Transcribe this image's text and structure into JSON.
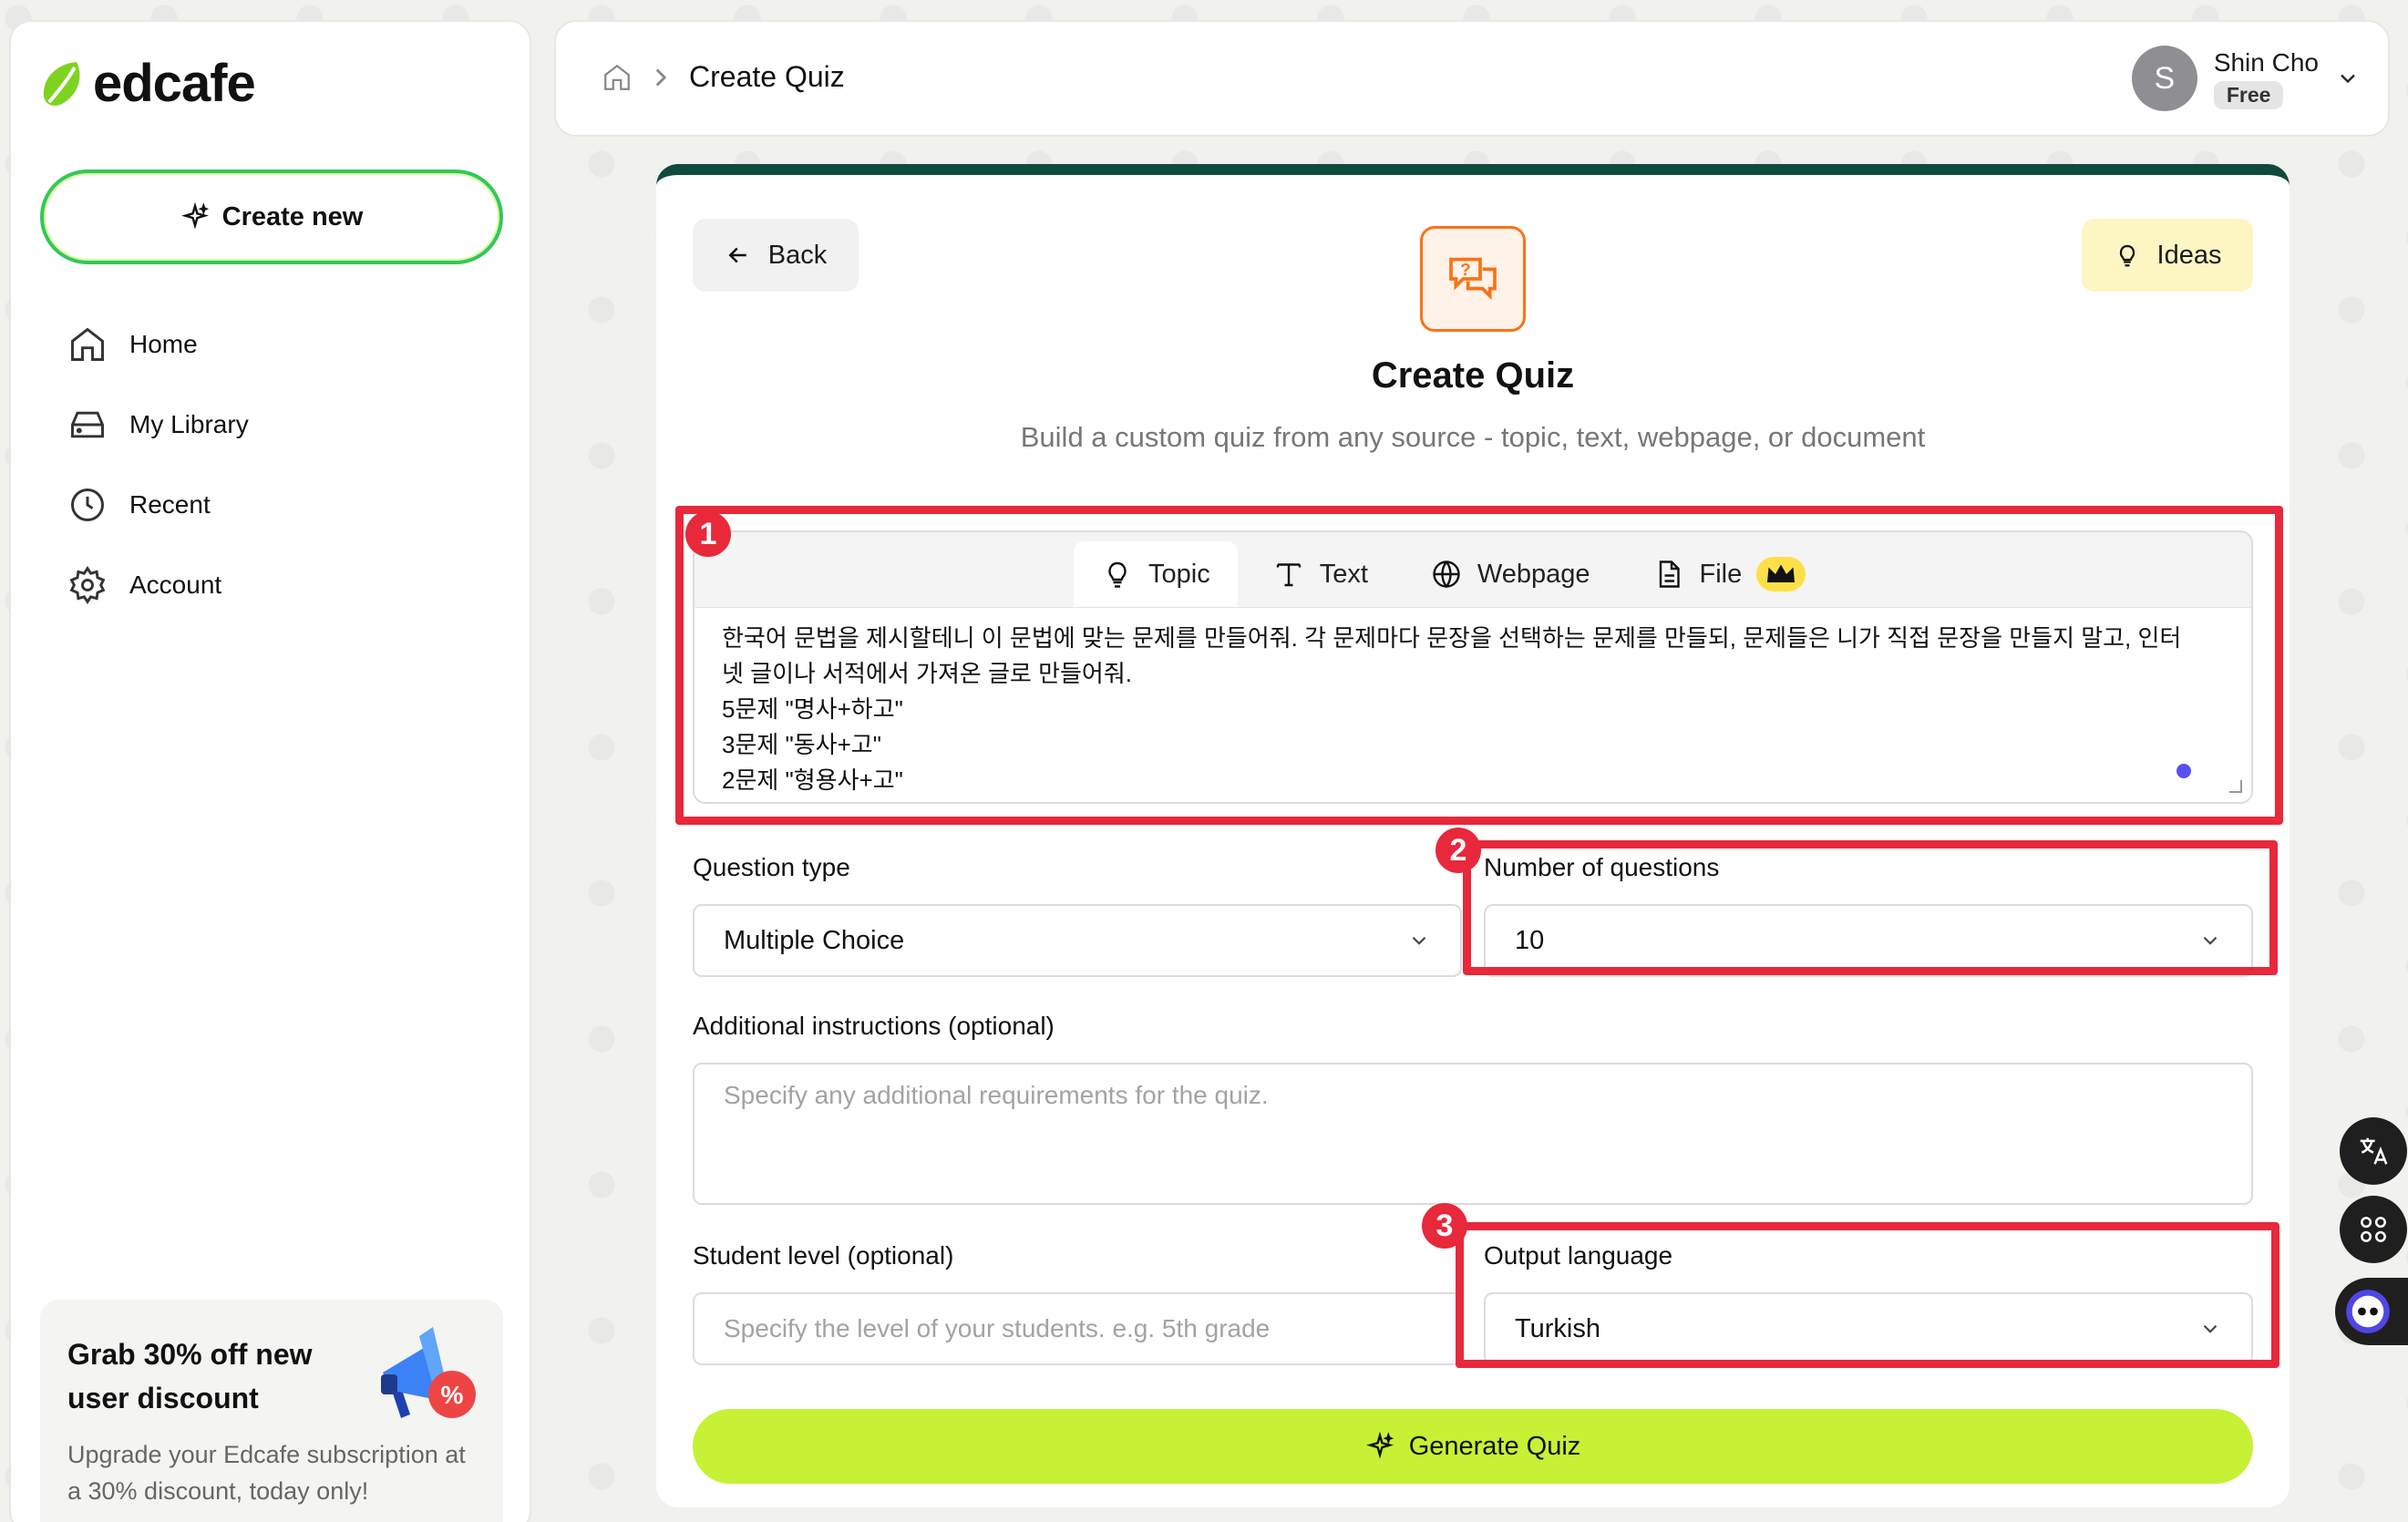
{
  "app": {
    "name": "edcafe"
  },
  "sidebar": {
    "create_new": "Create new",
    "items": [
      {
        "label": "Home",
        "icon": "home-icon"
      },
      {
        "label": "My Library",
        "icon": "library-icon"
      },
      {
        "label": "Recent",
        "icon": "clock-icon"
      },
      {
        "label": "Account",
        "icon": "gear-icon"
      }
    ],
    "promo": {
      "title": "Grab 30% off new user discount",
      "text": "Upgrade your Edcafe subscription at a 30% discount, today only!"
    }
  },
  "header": {
    "breadcrumb": "Create Quiz",
    "user": {
      "initial": "S",
      "name": "Shin Cho",
      "plan": "Free"
    }
  },
  "main": {
    "back_label": "Back",
    "ideas_label": "Ideas",
    "title": "Create Quiz",
    "subtitle": "Build a custom quiz from any source - topic, text, webpage, or document",
    "tabs": [
      {
        "label": "Topic",
        "icon": "lightbulb-icon"
      },
      {
        "label": "Text",
        "icon": "text-icon"
      },
      {
        "label": "Webpage",
        "icon": "globe-icon"
      },
      {
        "label": "File",
        "icon": "file-icon"
      }
    ],
    "topic_text": "한국어 문법을 제시할테니 이 문법에 맞는 문제를 만들어줘. 각 문제마다 문장을 선택하는 문제를 만들되, 문제들은 니가 직접 문장을 만들지 말고, 인터\n넷 글이나 서적에서 가져온 글로 만들어줘.\n5문제 \"명사+하고\"\n3문제 \"동사+고\"\n2문제 \"형용사+고\"",
    "question_type_label": "Question type",
    "question_type_value": "Multiple Choice",
    "num_questions_label": "Number of questions",
    "num_questions_value": "10",
    "additional_label": "Additional instructions (optional)",
    "additional_placeholder": "Specify any additional requirements for the quiz.",
    "student_level_label": "Student level (optional)",
    "student_level_placeholder": "Specify the level of your students. e.g. 5th grade",
    "output_language_label": "Output language",
    "output_language_value": "Turkish",
    "generate_label": "Generate Quiz"
  },
  "annotations": [
    "1",
    "2",
    "3"
  ],
  "colors": {
    "accent_green": "#34c759",
    "generate": "#c6f135",
    "annotation": "#e8283b",
    "card_top": "#0f4b3a"
  }
}
